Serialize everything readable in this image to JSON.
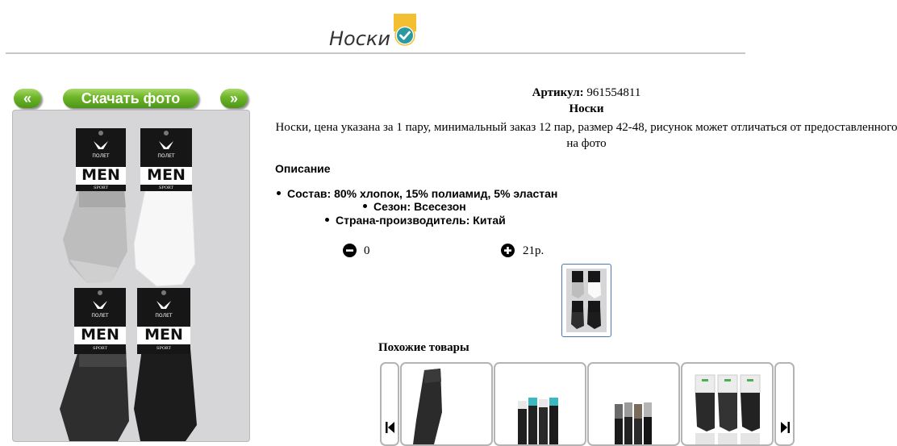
{
  "header": {
    "title": "Носки",
    "badge_icon": "check-badge-icon"
  },
  "gallery": {
    "prev_label": "«",
    "download_label": "Скачать фото",
    "next_label": "»",
    "packs": [
      "MEN",
      "MEN",
      "MEN",
      "MEN"
    ],
    "pack_subtitle": "SPORT",
    "pack_brand": "ПОЛЕТ"
  },
  "product": {
    "article_label": "Артикул:",
    "article_value": "961554811",
    "name": "Носки",
    "description": "Носки, цена указана за 1 пару, минимальный заказ 12 пар, размер 42-48, рисунок может отличаться от предоставленного на фото",
    "description_heading": "Описание",
    "features": [
      "Состав: 80% хлопок, 15% полиамид, 5% эластан",
      "Сезон: Всесезон",
      "Страна-производитель: Китай"
    ],
    "quantity": "0",
    "price": "21р."
  },
  "similar": {
    "heading": "Похожие товары"
  },
  "colors": {
    "button_green": "#6cb527",
    "thumb_border": "#4a78b0",
    "divider": "#c8c8c8"
  }
}
